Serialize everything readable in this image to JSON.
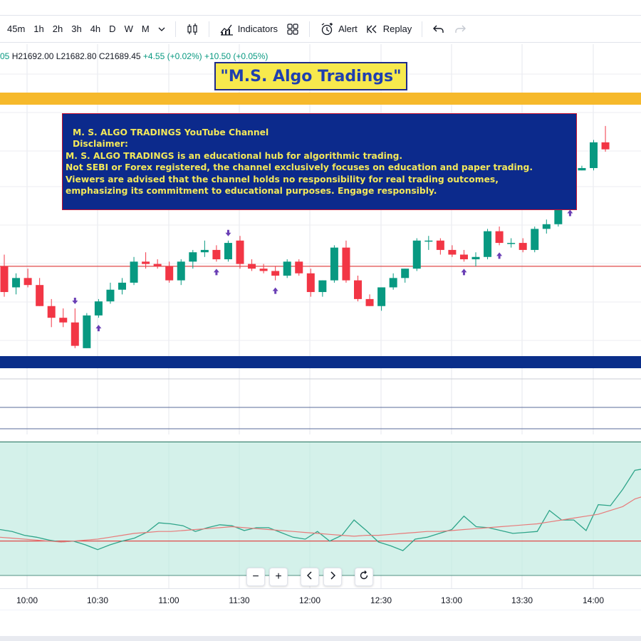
{
  "toolbar": {
    "timeframes": [
      "45m",
      "1h",
      "2h",
      "3h",
      "4h",
      "D",
      "W",
      "M"
    ],
    "indicators_label": "Indicators",
    "alert_label": "Alert",
    "replay_label": "Replay"
  },
  "legend": {
    "high": "H21692.00",
    "low": "L21682.80",
    "close": "C21689.45",
    "change": "+4.55 (+0.02%)",
    "change2": "+10.50 (+0.05%)",
    "open_partial": "05"
  },
  "banner": {
    "title": "\"M.S. Algo Tradings\""
  },
  "disclaimer": {
    "line1": "M. S. ALGO TRADINGS YouTube Channel",
    "line2": "Disclaimer:",
    "line3": "M. S. ALGO TRADINGS is an educational hub for algorithmic trading.",
    "line4": "Not SEBI or Forex registered, the channel exclusively focuses on education and paper trading.",
    "line5": "Viewers are advised that the channel holds no responsibility for real trading outcomes,",
    "line6": "emphasizing its commitment to educational purposes. Engage responsibly."
  },
  "time_axis": [
    "10:00",
    "10:30",
    "11:00",
    "11:30",
    "12:00",
    "12:30",
    "13:00",
    "13:30",
    "14:00"
  ],
  "colors": {
    "up": "#089981",
    "down": "#f23645",
    "band_yellow": "#f6b92b",
    "band_blue": "#0a2e8a",
    "arrow": "#6a3fb5",
    "hline": "#e04a4a",
    "indicator_fill": "#cdeee6",
    "indicator_line": "#2fa58a",
    "indicator_ma": "#e87a7a"
  },
  "chart_data": {
    "type": "candlestick",
    "candles": [
      [
        21677,
        21682,
        21664,
        21666
      ],
      [
        21668,
        21674,
        21665,
        21672
      ],
      [
        21672,
        21676,
        21668,
        21669
      ],
      [
        21669,
        21672,
        21660,
        21660
      ],
      [
        21660,
        21663,
        21651,
        21655
      ],
      [
        21655,
        21659,
        21651,
        21653
      ],
      [
        21653,
        21659,
        21642,
        21643
      ],
      [
        21642,
        21657,
        21642,
        21656
      ],
      [
        21656,
        21663,
        21655,
        21662
      ],
      [
        21662,
        21670,
        21661,
        21667
      ],
      [
        21667,
        21672,
        21665,
        21670
      ],
      [
        21670,
        21681,
        21669,
        21679
      ],
      [
        21679,
        21683,
        21676,
        21678
      ],
      [
        21678,
        21680,
        21676,
        21677
      ],
      [
        21677,
        21679,
        21670,
        21671
      ],
      [
        21671,
        21680,
        21669,
        21679
      ],
      [
        21679,
        21684,
        21676,
        21683
      ],
      [
        21683,
        21688,
        21681,
        21684
      ],
      [
        21684,
        21686,
        21679,
        21680
      ],
      [
        21680,
        21688,
        21679,
        21687
      ],
      [
        21688,
        21690,
        21676,
        21678
      ],
      [
        21678,
        21680,
        21675,
        21676
      ],
      [
        21676,
        21678,
        21674,
        21675
      ],
      [
        21675,
        21677,
        21671,
        21673
      ],
      [
        21673,
        21680,
        21672,
        21679
      ],
      [
        21679,
        21680,
        21673,
        21674
      ],
      [
        21674,
        21676,
        21664,
        21666
      ],
      [
        21666,
        21671,
        21664,
        21671
      ],
      [
        21671,
        21686,
        21670,
        21685
      ],
      [
        21685,
        21688,
        21670,
        21671
      ],
      [
        21671,
        21673,
        21662,
        21663
      ],
      [
        21663,
        21665,
        21660,
        21660
      ],
      [
        21660,
        21668,
        21658,
        21668
      ],
      [
        21668,
        21674,
        21667,
        21672
      ],
      [
        21672,
        21676,
        21670,
        21676
      ],
      [
        21676,
        21689,
        21675,
        21688
      ],
      [
        21688,
        21690,
        21684,
        21688
      ],
      [
        21688,
        21689,
        21682,
        21684
      ],
      [
        21684,
        21686,
        21681,
        21682
      ],
      [
        21682,
        21684,
        21679,
        21680
      ],
      [
        21680,
        21683,
        21677,
        21681
      ],
      [
        21681,
        21693,
        21680,
        21692
      ],
      [
        21692,
        21694,
        21686,
        21687
      ],
      [
        21687,
        21689,
        21685,
        21687
      ],
      [
        21687,
        21689,
        21683,
        21684
      ],
      [
        21684,
        21694,
        21683,
        21693
      ],
      [
        21693,
        21697,
        21691,
        21695
      ],
      [
        21695,
        21699,
        21694,
        21704
      ],
      [
        21704,
        21719,
        21703,
        21718
      ],
      [
        21718,
        21720,
        21718,
        21719
      ],
      [
        21719,
        21731,
        21718,
        21730
      ],
      [
        21730,
        21737,
        21726,
        21727
      ]
    ],
    "buy_arrows": [
      8,
      18,
      23,
      39,
      42
    ],
    "sell_arrows": [
      6,
      19
    ],
    "sell_arrow_after": [
      48
    ],
    "hline_price": 21677,
    "ylim": [
      21638,
      21740
    ],
    "indicator": {
      "line": [
        48,
        46,
        42,
        40,
        37,
        35,
        36,
        32,
        27,
        32,
        36,
        39,
        45,
        55,
        54,
        52,
        46,
        50,
        53,
        52,
        47,
        50,
        50,
        45,
        40,
        38,
        46,
        36,
        42,
        58,
        47,
        35,
        31,
        26,
        38,
        40,
        44,
        48,
        62,
        51,
        50,
        47,
        44,
        45,
        46,
        68,
        58,
        58,
        47,
        74,
        73,
        90,
        110,
        112
      ],
      "ma": [
        40,
        39,
        38,
        37,
        36,
        35,
        36,
        37,
        38,
        40,
        42,
        44,
        45,
        46,
        46,
        47,
        48,
        49,
        50,
        51,
        50,
        49,
        48,
        47,
        46,
        45,
        44,
        43,
        42,
        41,
        42,
        42,
        43,
        44,
        45,
        46,
        46,
        47,
        48,
        49,
        50,
        51,
        52,
        53,
        54,
        56,
        58,
        60,
        62,
        64,
        68,
        72,
        80,
        84
      ],
      "hline": 36,
      "ylim": [
        0,
        140
      ]
    }
  }
}
